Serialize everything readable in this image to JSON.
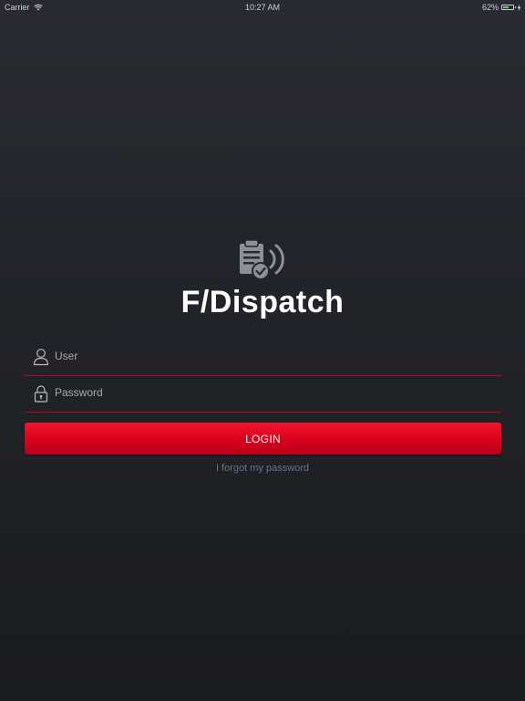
{
  "status_bar": {
    "carrier": "Carrier",
    "time": "10:27 AM",
    "battery_text": "62%",
    "battery_level": 0.62
  },
  "app": {
    "name": "F/Dispatch",
    "logo_icon": "clipboard-check-broadcast-icon"
  },
  "form": {
    "user_placeholder": "User",
    "user_value": "",
    "user_icon": "user-icon",
    "password_placeholder": "Password",
    "password_value": "",
    "password_icon": "lock-icon",
    "login_label": "LOGIN",
    "forgot_label": "I forgot my password"
  },
  "colors": {
    "accent": "#d9001c",
    "background": "#232428",
    "link": "#6d7188",
    "battery": "#4cd964"
  }
}
